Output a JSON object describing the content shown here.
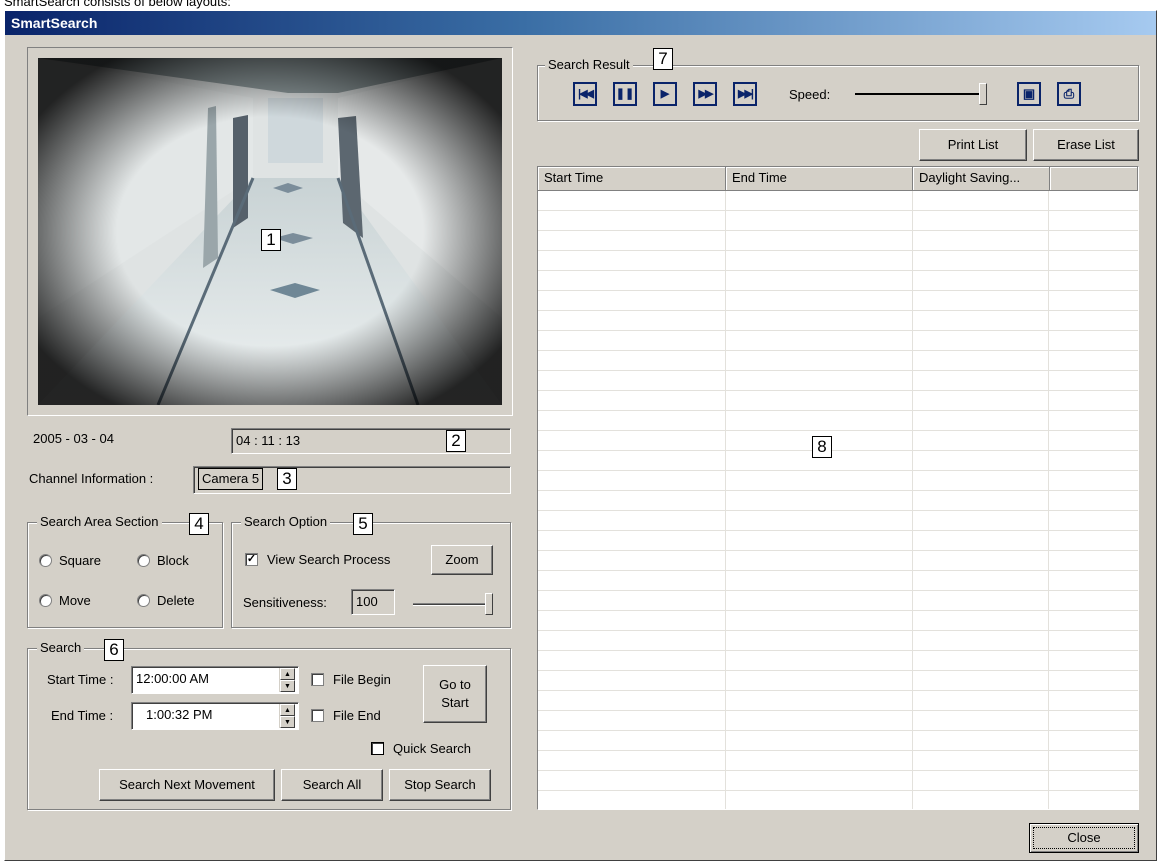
{
  "caption": "SmartSearch consists of below layouts:",
  "window": {
    "title": "SmartSearch"
  },
  "callouts": [
    "1",
    "2",
    "3",
    "4",
    "5",
    "6",
    "7",
    "8"
  ],
  "video": {
    "date": "2005 - 03 - 04",
    "time": "04 : 11 : 13"
  },
  "channel": {
    "label": "Channel Information :",
    "value": "Camera 5"
  },
  "search_area": {
    "legend": "Search Area Section",
    "options": [
      "Square",
      "Block",
      "Move",
      "Delete"
    ]
  },
  "search_option": {
    "legend": "Search Option",
    "view_process_label": "View Search Process",
    "view_process_checked": true,
    "zoom_label": "Zoom",
    "sensitiveness_label": "Sensitiveness:",
    "sensitiveness_value": "100",
    "sensitiveness_level": 1.0
  },
  "search": {
    "legend": "Search",
    "start_label": "Start Time :",
    "start_value": "12:00:00 AM",
    "end_label": "End Time :",
    "end_value": "1:00:32 PM",
    "file_begin_label": "File Begin",
    "file_end_label": "File End",
    "go_to_start_label": "Go to Start",
    "quick_search_label": "Quick Search",
    "search_next_label": "Search Next Movement",
    "search_all_label": "Search All",
    "stop_search_label": "Stop Search"
  },
  "search_result": {
    "legend": "Search Result",
    "speed_label": "Speed:",
    "speed_level": 1.0,
    "controls": [
      "skip-back-icon",
      "pause-icon",
      "play-icon",
      "fast-forward-icon",
      "skip-forward-icon"
    ],
    "print_list_label": "Print List",
    "erase_list_label": "Erase List",
    "columns": [
      "Start Time",
      "End Time",
      "Daylight Saving..."
    ]
  },
  "close_label": "Close",
  "colors": {
    "title_start": "#0a246a",
    "title_end": "#a6caf0",
    "face": "#d4d0c8",
    "media_icon": "#0a246a"
  }
}
